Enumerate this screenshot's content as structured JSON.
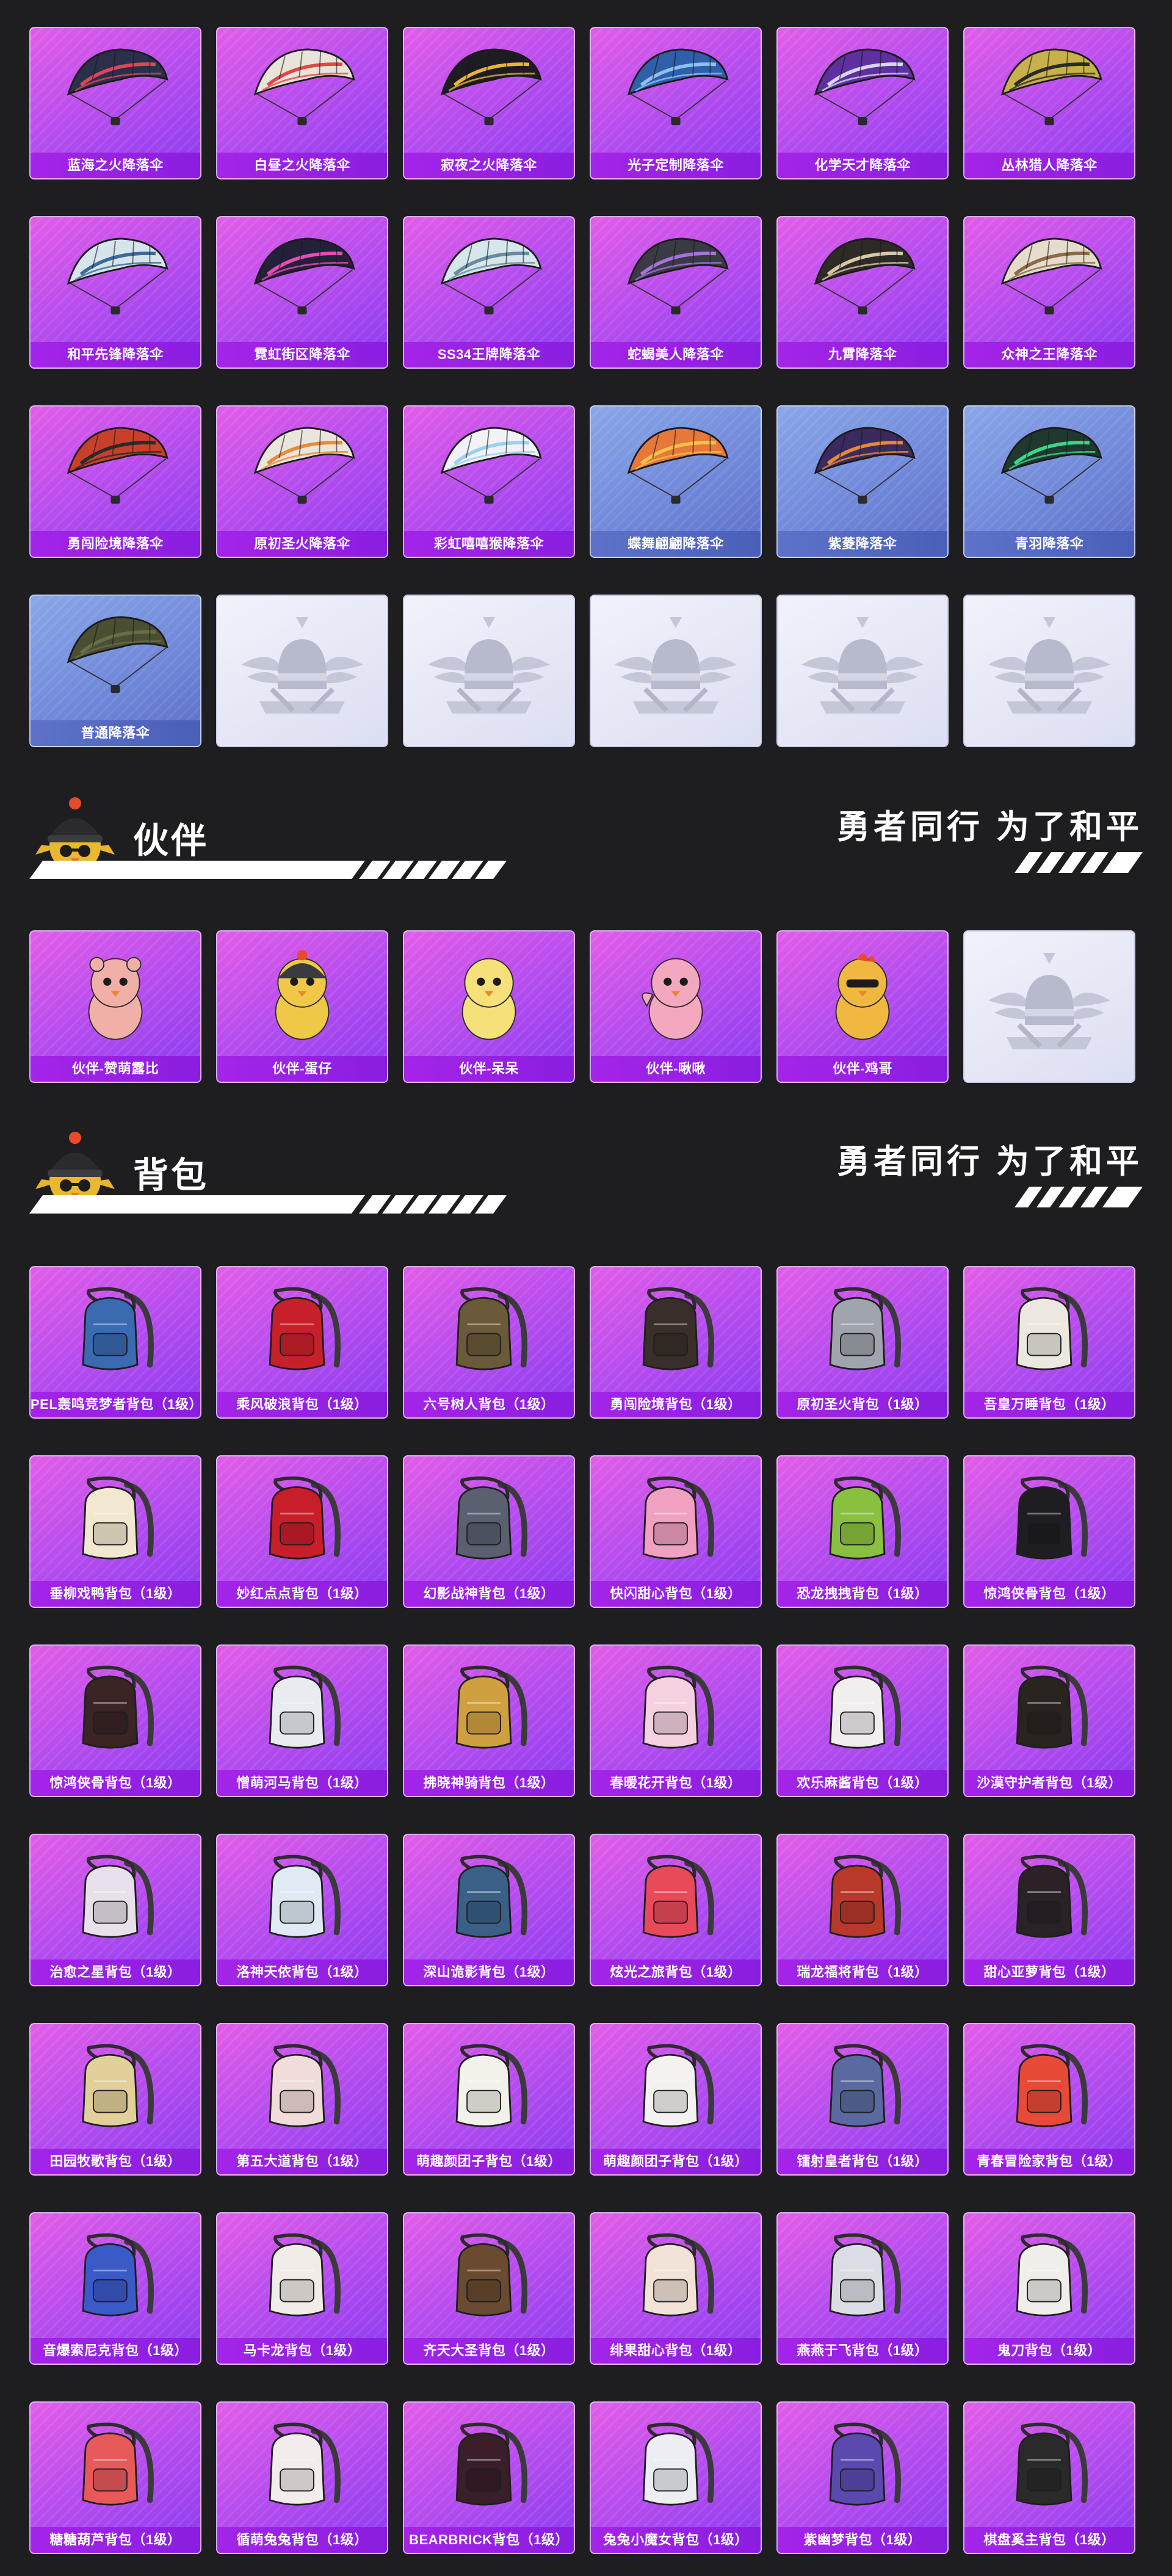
{
  "colors": {
    "page_bg": "#1e1e20",
    "card_purple": "#b14bef",
    "card_blue": "#6f86d8",
    "card_empty": "#e6e8f6",
    "label_purple": "#a424e8",
    "label_blue": "#5d72c8"
  },
  "parachutes": [
    {
      "label": "蓝海之火降落伞",
      "style": "purple",
      "icon": "parachute-icon",
      "color": "#2a2f4a",
      "accent": "#e0445a"
    },
    {
      "label": "白昼之火降落伞",
      "style": "purple",
      "icon": "parachute-icon",
      "color": "#e9e3da",
      "accent": "#e04848"
    },
    {
      "label": "寂夜之火降落伞",
      "style": "purple",
      "icon": "parachute-icon",
      "color": "#1c1c22",
      "accent": "#e8b43a"
    },
    {
      "label": "光子定制降落伞",
      "style": "purple",
      "icon": "parachute-icon",
      "color": "#2f5fa8",
      "accent": "#8ec1f0"
    },
    {
      "label": "化学天才降落伞",
      "style": "purple",
      "icon": "parachute-icon",
      "color": "#5e2f9e",
      "accent": "#d6d6f2"
    },
    {
      "label": "丛林猎人降落伞",
      "style": "purple",
      "icon": "parachute-icon",
      "color": "#c8b04a",
      "accent": "#2b2b2b"
    },
    {
      "label": "和平先锋降落伞",
      "style": "purple",
      "icon": "parachute-icon",
      "color": "#d8e4ec",
      "accent": "#3a6a9a"
    },
    {
      "label": "霓虹街区降落伞",
      "style": "purple",
      "icon": "parachute-icon",
      "color": "#23213a",
      "accent": "#e84ab8"
    },
    {
      "label": "SS34王牌降落伞",
      "style": "purple",
      "icon": "parachute-icon",
      "color": "#d6e6ea",
      "accent": "#6a8aa0"
    },
    {
      "label": "蛇蝎美人降落伞",
      "style": "purple",
      "icon": "parachute-icon",
      "color": "#3a3a44",
      "accent": "#a870e0"
    },
    {
      "label": "九霄降落伞",
      "style": "purple",
      "icon": "parachute-icon",
      "color": "#2e2a26",
      "accent": "#d8c8a8"
    },
    {
      "label": "众神之王降落伞",
      "style": "purple",
      "icon": "parachute-icon",
      "color": "#e6dccb",
      "accent": "#8a6a4a"
    },
    {
      "label": "勇闯险境降落伞",
      "style": "purple",
      "icon": "parachute-icon",
      "color": "#c8402a",
      "accent": "#2a2a2a"
    },
    {
      "label": "原初圣火降落伞",
      "style": "purple",
      "icon": "parachute-icon",
      "color": "#eae6dc",
      "accent": "#e88a3a"
    },
    {
      "label": "彩虹嘻嘻猴降落伞",
      "style": "purple",
      "icon": "parachute-icon",
      "color": "#f2f2f6",
      "accent": "#9ad0f0"
    },
    {
      "label": "蝶舞翩翩降落伞",
      "style": "blue",
      "icon": "parachute-icon",
      "color": "#e8783a",
      "accent": "#f2c24a"
    },
    {
      "label": "紫菱降落伞",
      "style": "blue",
      "icon": "parachute-icon",
      "color": "#3a2a5e",
      "accent": "#e8883a"
    },
    {
      "label": "青羽降落伞",
      "style": "blue",
      "icon": "parachute-icon",
      "color": "#1e3a2e",
      "accent": "#3ad88a"
    },
    {
      "label": "普通降落伞",
      "style": "blue",
      "icon": "parachute-icon",
      "color": "#4a4e32",
      "accent": "#6a6e48"
    },
    {
      "label": "",
      "style": "empty",
      "icon": "emblem-icon"
    },
    {
      "label": "",
      "style": "empty",
      "icon": "emblem-icon"
    },
    {
      "label": "",
      "style": "empty",
      "icon": "emblem-icon"
    },
    {
      "label": "",
      "style": "empty",
      "icon": "emblem-icon"
    },
    {
      "label": "",
      "style": "empty",
      "icon": "emblem-icon"
    }
  ],
  "companion_section": {
    "title": "伙伴",
    "slogan": "勇者同行 为了和平",
    "mascot_icon": "chick-mascot-icon"
  },
  "companions": [
    {
      "label": "伙伴-赞萌露比",
      "style": "purple",
      "icon": "beaver-companion-icon",
      "color": "#f0b0a8"
    },
    {
      "label": "伙伴-蛋仔",
      "style": "purple",
      "icon": "helmet-chick-companion-icon",
      "color": "#f0c848"
    },
    {
      "label": "伙伴-呆呆",
      "style": "purple",
      "icon": "chick-companion-icon",
      "color": "#f6e07a"
    },
    {
      "label": "伙伴-啾啾",
      "style": "purple",
      "icon": "pink-bird-companion-icon",
      "color": "#f4a8c0"
    },
    {
      "label": "伙伴-鸡哥",
      "style": "purple",
      "icon": "rooster-companion-icon",
      "color": "#f0b840"
    },
    {
      "label": "",
      "style": "empty",
      "icon": "emblem-icon"
    }
  ],
  "backpack_section": {
    "title": "背包",
    "slogan": "勇者同行 为了和平",
    "mascot_icon": "chick-mascot-icon"
  },
  "backpacks": [
    {
      "label": "PEL轰鸣竞梦者背包（1级）",
      "icon": "backpack-icon",
      "color": "#3a6ab0"
    },
    {
      "label": "乘风破浪背包（1级）",
      "icon": "backpack-icon",
      "color": "#c8202a"
    },
    {
      "label": "六号树人背包（1级）",
      "icon": "backpack-icon",
      "color": "#6a5a3a"
    },
    {
      "label": "勇闯险境背包（1级）",
      "icon": "backpack-icon",
      "color": "#3a2e2a"
    },
    {
      "label": "原初圣火背包（1级）",
      "icon": "backpack-icon",
      "color": "#a0a4ac"
    },
    {
      "label": "吾皇万睡背包（1级）",
      "icon": "backpack-icon",
      "color": "#ece8e0"
    },
    {
      "label": "垂柳戏鸭背包（1级）",
      "icon": "backpack-icon",
      "color": "#f2e8d0"
    },
    {
      "label": "妙红点点背包（1级）",
      "icon": "backpack-icon",
      "color": "#c81e2a"
    },
    {
      "label": "幻影战神背包（1级）",
      "icon": "backpack-icon",
      "color": "#5a6070"
    },
    {
      "label": "快闪甜心背包（1级）",
      "icon": "backpack-icon",
      "color": "#f0a0c0"
    },
    {
      "label": "恐龙拽拽背包（1级）",
      "icon": "backpack-icon",
      "color": "#8ac040"
    },
    {
      "label": "惊鸿侠骨背包（1级）",
      "icon": "backpack-icon",
      "color": "#1e1e22"
    },
    {
      "label": "惊鸿侠骨背包（1级）",
      "icon": "backpack-icon",
      "color": "#3a2424"
    },
    {
      "label": "憎萌河马背包（1级）",
      "icon": "backpack-icon",
      "color": "#e8ecf0"
    },
    {
      "label": "拂晓神骑背包（1级）",
      "icon": "backpack-icon",
      "color": "#d0a040"
    },
    {
      "label": "春暖花开背包（1级）",
      "icon": "backpack-icon",
      "color": "#f4d0e0"
    },
    {
      "label": "欢乐麻酱背包（1级）",
      "icon": "backpack-icon",
      "color": "#f2eef0"
    },
    {
      "label": "沙漠守护者背包（1级）",
      "icon": "backpack-icon",
      "color": "#2a2420"
    },
    {
      "label": "治愈之星背包（1级）",
      "icon": "backpack-icon",
      "color": "#e8e0ea"
    },
    {
      "label": "洛神天依背包（1级）",
      "icon": "backpack-icon",
      "color": "#dfeaf4"
    },
    {
      "label": "深山诡影背包（1级）",
      "icon": "backpack-icon",
      "color": "#3a6088"
    },
    {
      "label": "炫光之旅背包（1级）",
      "icon": "backpack-icon",
      "color": "#e84a5a"
    },
    {
      "label": "瑞龙福将背包（1级）",
      "icon": "backpack-icon",
      "color": "#b8382a"
    },
    {
      "label": "甜心亚萝背包（1级）",
      "icon": "backpack-icon",
      "color": "#2a2226"
    },
    {
      "label": "田园牧歌背包（1级）",
      "icon": "backpack-icon",
      "color": "#e2cf9a"
    },
    {
      "label": "第五大道背包（1级）",
      "icon": "backpack-icon",
      "color": "#f0dcd8"
    },
    {
      "label": "萌趣颜团子背包（1级）",
      "icon": "backpack-icon",
      "color": "#f2f2ea"
    },
    {
      "label": "萌趣颜团子背包（1级）",
      "icon": "backpack-icon",
      "color": "#f4f2f0"
    },
    {
      "label": "镭射皇者背包（1级）",
      "icon": "backpack-icon",
      "color": "#5a6aa0"
    },
    {
      "label": "青春冒险家背包（1级）",
      "icon": "backpack-icon",
      "color": "#e84a38"
    },
    {
      "label": "音爆索尼克背包（1级）",
      "icon": "backpack-icon",
      "color": "#3a5ac8"
    },
    {
      "label": "马卡龙背包（1级）",
      "icon": "backpack-icon",
      "color": "#f2ece8"
    },
    {
      "label": "齐天大圣背包（1级）",
      "icon": "backpack-icon",
      "color": "#6a4a30"
    },
    {
      "label": "绯果甜心背包（1级）",
      "icon": "backpack-icon",
      "color": "#f2e2d8"
    },
    {
      "label": "燕燕于飞背包（1级）",
      "icon": "backpack-icon",
      "color": "#dadde4"
    },
    {
      "label": "鬼刀背包（1级）",
      "icon": "backpack-icon",
      "color": "#f0eeea"
    },
    {
      "label": "糖糖葫芦背包（1级）",
      "icon": "backpack-icon",
      "color": "#e85a5a"
    },
    {
      "label": "循萌兔兔背包（1级）",
      "icon": "backpack-icon",
      "color": "#f2ecea"
    },
    {
      "label": "BEARBRICK背包（1级）",
      "icon": "backpack-icon",
      "color": "#3a1e2a"
    },
    {
      "label": "兔兔小魔女背包（1级）",
      "icon": "backpack-icon",
      "color": "#eceef4"
    },
    {
      "label": "紫幽梦背包（1级）",
      "icon": "backpack-icon",
      "color": "#5a4ab0"
    },
    {
      "label": "棋盘奚主背包（1级）",
      "icon": "backpack-icon",
      "color": "#2a2a2a"
    }
  ]
}
